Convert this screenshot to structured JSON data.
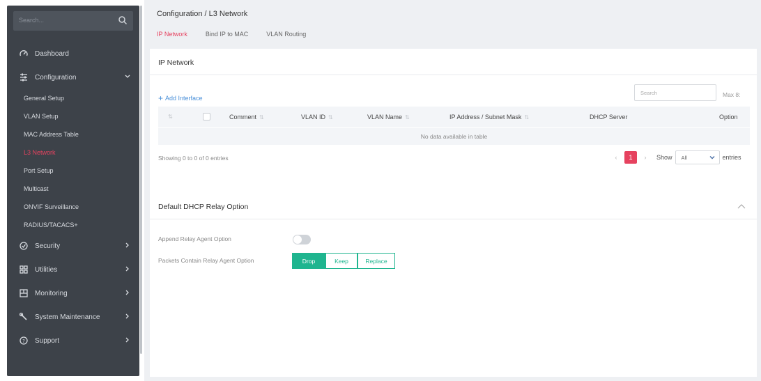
{
  "sidebar": {
    "search_placeholder": "Search...",
    "items": [
      {
        "label": "Dashboard",
        "icon": "dashboard-icon"
      },
      {
        "label": "Configuration",
        "icon": "configuration-icon",
        "expanded": true
      },
      {
        "label": "Security",
        "icon": "security-icon"
      },
      {
        "label": "Utilities",
        "icon": "utilities-icon"
      },
      {
        "label": "Monitoring",
        "icon": "monitoring-icon"
      },
      {
        "label": "System Maintenance",
        "icon": "system-maintenance-icon"
      },
      {
        "label": "Support",
        "icon": "support-icon"
      }
    ],
    "sub_items": [
      {
        "label": "General Setup"
      },
      {
        "label": "VLAN Setup"
      },
      {
        "label": "MAC Address Table"
      },
      {
        "label": "L3 Network",
        "active": true
      },
      {
        "label": "Port Setup"
      },
      {
        "label": "Multicast"
      },
      {
        "label": "ONVIF Surveillance"
      },
      {
        "label": "RADIUS/TACACS+"
      }
    ]
  },
  "header": {
    "breadcrumb": "Configuration / L3 Network",
    "tabs": [
      {
        "label": "IP Network",
        "active": true
      },
      {
        "label": "Bind IP to MAC"
      },
      {
        "label": "VLAN Routing"
      }
    ]
  },
  "ip_network": {
    "title": "IP Network",
    "add_label": "Add Interface",
    "search_placeholder": "Search",
    "max_label": "Max 8:",
    "columns": [
      "Comment",
      "VLAN ID",
      "VLAN Name",
      "IP Address / Subnet Mask",
      "DHCP Server",
      "Option"
    ],
    "empty_text": "No data available in table",
    "showing_text": "Showing 0 to 0 of 0 entries",
    "pagination": {
      "prev": "‹",
      "current": "1",
      "next": "›"
    },
    "show_label": "Show",
    "show_value": "All",
    "entries_label": "entries"
  },
  "relay": {
    "title": "Default DHCP Relay Option",
    "append_label": "Append Relay Agent Option",
    "append_enabled": false,
    "packets_label": "Packets Contain Relay Agent Option",
    "options": [
      "Drop",
      "Keep",
      "Replace"
    ],
    "selected": "Drop"
  },
  "colors": {
    "accent": "#e6425f",
    "green": "#1fb58f",
    "sidebar_bg": "#3d4249",
    "link": "#4a90d9"
  }
}
